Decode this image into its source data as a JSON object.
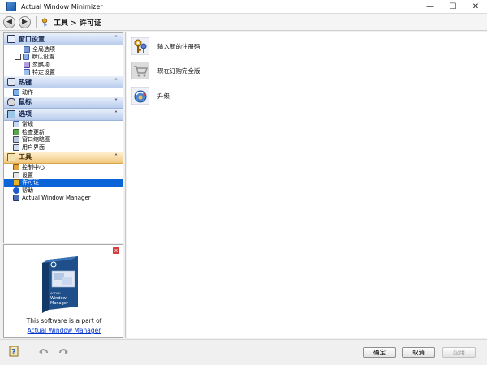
{
  "window": {
    "title": "Actual Window Minimizer",
    "controls": {
      "minimize": "—",
      "maximize": "☐",
      "close": "✕"
    }
  },
  "nav": {
    "back": "◀",
    "forward": "▶",
    "breadcrumb": "工具 > 许可证"
  },
  "sidebar": {
    "groups": [
      {
        "label": "窗口设置",
        "chevron": "˄",
        "items": [
          "全局选项",
          "默认设置",
          "忽略项",
          "特定设置"
        ]
      },
      {
        "label": "热键",
        "chevron": "˄",
        "items": [
          "动作"
        ]
      },
      {
        "label": "鼠标",
        "chevron": "˅",
        "items": []
      },
      {
        "label": "选项",
        "chevron": "˄",
        "items": [
          "常规",
          "检查更新",
          "窗口缩略图",
          "用户界面"
        ]
      },
      {
        "label": "工具",
        "chevron": "˄",
        "items": [
          "控制中心",
          "设置",
          "许可证",
          "帮助",
          "Actual Window Manager"
        ]
      }
    ]
  },
  "promo": {
    "close": "x",
    "box_brand": "ACTUAL",
    "box_title1": "Window",
    "box_title2": "Manager",
    "line1": "This software is a part of",
    "link": "Actual Window Manager"
  },
  "main": {
    "actions": [
      "输入新的注册码",
      "现在订购完全版",
      "升级"
    ]
  },
  "footer": {
    "ok": "确定",
    "cancel": "取消",
    "apply": "应用"
  },
  "colors": {
    "selection": "#0a64d8",
    "group_header": "#b9cdee",
    "active_group": "#f2c77e",
    "link": "#0033cc"
  }
}
